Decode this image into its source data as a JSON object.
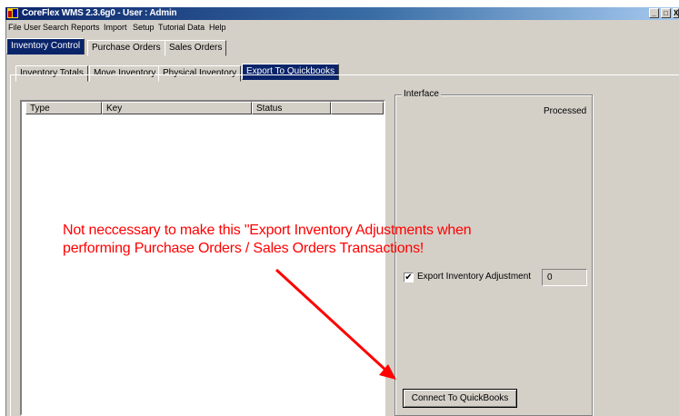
{
  "window": {
    "title": "CoreFlex WMS 2.3.6g0 - User : Admin",
    "buttons": [
      "_",
      "□",
      "X"
    ]
  },
  "menu": [
    "File",
    "User",
    "Search",
    "Reports",
    "Import",
    "Setup",
    "Tutorial Data",
    "Help"
  ],
  "main_tabs": [
    {
      "label": "Inventory Control",
      "active": true
    },
    {
      "label": "Purchase Orders",
      "active": false
    },
    {
      "label": "Sales Orders",
      "active": false
    }
  ],
  "sub_tabs": [
    {
      "label": "Inventory Totals",
      "active": false
    },
    {
      "label": "Move Inventory",
      "active": false
    },
    {
      "label": "Physical Inventory",
      "active": false
    },
    {
      "label": "Export To Quickbooks",
      "active": true
    }
  ],
  "table": {
    "columns": [
      "Type",
      "Key",
      "Status",
      ""
    ],
    "rows": []
  },
  "interface": {
    "legend": "Interface",
    "processed_label": "Processed",
    "export_adjustment_label": "Export Inventory Adjustment",
    "export_adjustment_checked": true,
    "export_adjustment_value": "0",
    "connect_button": "Connect To QuickBooks"
  },
  "annotation": {
    "text": "Not neccessary to make this \"Export Inventory Adjustments when\nperforming Purchase Orders / Sales Orders Transactions!",
    "color": "#ff0000"
  }
}
